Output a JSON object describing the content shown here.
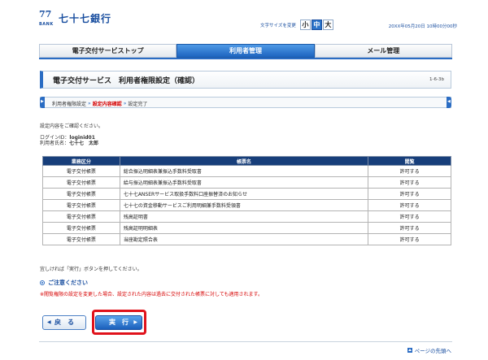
{
  "header": {
    "logo_mark": "77",
    "logo_bank": "BANK",
    "logo_name": "七十七銀行",
    "fontsize_label": "文字サイズを変更",
    "fontsize_options": [
      "小",
      "中",
      "大"
    ],
    "datetime": "20XX年05月20日 10時00分00秒"
  },
  "tabs": [
    {
      "label": "電子交付サービストップ",
      "active": false
    },
    {
      "label": "利用者管理",
      "active": true
    },
    {
      "label": "メール管理",
      "active": false
    }
  ],
  "title": {
    "text": "電子交付サービス　利用者権限設定（確認）",
    "code": "1-6-3b"
  },
  "steps": {
    "step1": "利用者権限設定",
    "step2": "設定内容確認",
    "step3": "設定完了",
    "arrow": "»"
  },
  "confirm_text": "設定内容をご確認ください。",
  "login_label": "ログインID：",
  "login_value": "loginid01",
  "user_label": "利用者氏名：",
  "user_value": "七十七　太郎",
  "table": {
    "headers": [
      "業務区分",
      "帳票名",
      "閲覧"
    ],
    "rows": [
      [
        "電子交付帳票",
        "総合振込明細表兼振込手数料受取書",
        "許可する"
      ],
      [
        "電子交付帳票",
        "給与振込明細表兼振込手数料受取書",
        "許可する"
      ],
      [
        "電子交付帳票",
        "七十七ANSERサービス取扱手数料口座振替済のお知らせ",
        "許可する"
      ],
      [
        "電子交付帳票",
        "七十七の資金移動サービスご利用明細兼手数料受領書",
        "許可する"
      ],
      [
        "電子交付帳票",
        "残高証明書",
        "許可する"
      ],
      [
        "電子交付帳票",
        "残高証明明細表",
        "許可する"
      ],
      [
        "電子交付帳票",
        "当座勘定照合表",
        "許可する"
      ]
    ]
  },
  "instruction": "宜しければ「実行」ボタンを押してください。",
  "caution_heading": "ご注意ください",
  "caution_text": "※閲覧権限の設定を変更した場合、設定された内容は過去に交付された帳票に対しても適用されます。",
  "buttons": {
    "back": "戻　る",
    "execute": "実　行",
    "back_arrow": "◀",
    "exec_arrow": "▶"
  },
  "pagetop": "ページの先頭へ"
}
